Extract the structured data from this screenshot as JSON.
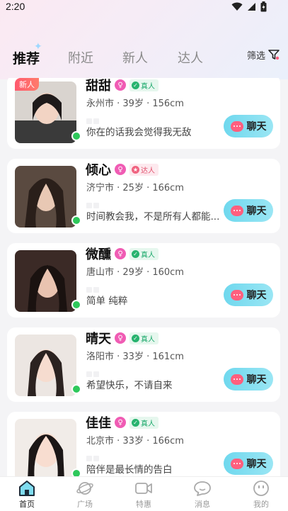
{
  "status": {
    "time": "2:20"
  },
  "tabs": [
    {
      "label": "推荐",
      "active": true
    },
    {
      "label": "附近",
      "active": false
    },
    {
      "label": "新人",
      "active": false
    },
    {
      "label": "达人",
      "active": false
    }
  ],
  "filter_label": "筛选",
  "cards": [
    {
      "name": "甜甜",
      "tag": "真人",
      "tag_type": "real",
      "info": "永州市 · 39岁 · 156cm",
      "bio": "你在的话我会觉得我无敌",
      "new_badge": "新人",
      "chat": "聊天"
    },
    {
      "name": "倾心",
      "tag": "达人",
      "tag_type": "expert",
      "info": "济宁市 · 25岁 · 166cm",
      "bio": "时间教会我，不是所有人都能...",
      "chat": "聊天"
    },
    {
      "name": "微醺",
      "tag": "真人",
      "tag_type": "real",
      "info": "唐山市 · 29岁 · 160cm",
      "bio": "简单  纯粹",
      "chat": "聊天"
    },
    {
      "name": "晴天",
      "tag": "真人",
      "tag_type": "real",
      "info": "洛阳市 · 33岁 · 161cm",
      "bio": "希望快乐，不请自来",
      "chat": "聊天"
    },
    {
      "name": "佳佳",
      "tag": "真人",
      "tag_type": "real",
      "info": "北京市 · 33岁 · 166cm",
      "bio": "陪伴是最长情的告白",
      "chat": "聊天"
    }
  ],
  "nav": [
    {
      "label": "首页",
      "icon": "home-icon",
      "active": true
    },
    {
      "label": "广场",
      "icon": "planet-icon",
      "active": false
    },
    {
      "label": "特惠",
      "icon": "video-icon",
      "active": false
    },
    {
      "label": "消息",
      "icon": "message-icon",
      "active": false
    },
    {
      "label": "我的",
      "icon": "profile-icon",
      "active": false
    }
  ],
  "colors": {
    "accent": "#6fd8ee",
    "chat_bubble": "#ff5f7e",
    "online": "#2ec85b",
    "gender": "#f05cb4"
  }
}
